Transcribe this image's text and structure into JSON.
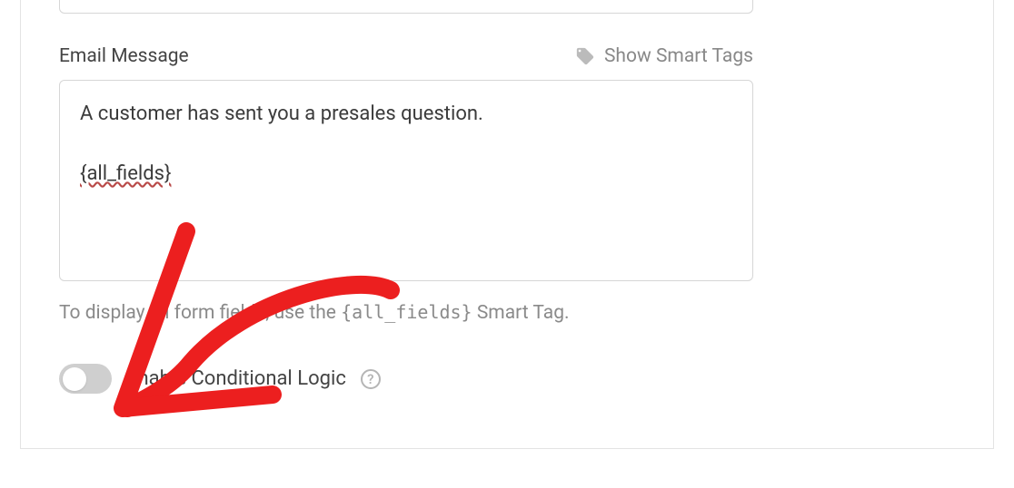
{
  "email_message": {
    "label": "Email Message",
    "smart_tags_link": "Show Smart Tags",
    "content_line1": "A customer has sent you a presales question.",
    "content_tag": "{all_fields}",
    "hint_prefix": "To display all form fields, use the ",
    "hint_code": "{all_fields}",
    "hint_suffix": " Smart Tag."
  },
  "conditional_logic": {
    "label": "Enable Conditional Logic",
    "enabled": false,
    "help": "?"
  }
}
